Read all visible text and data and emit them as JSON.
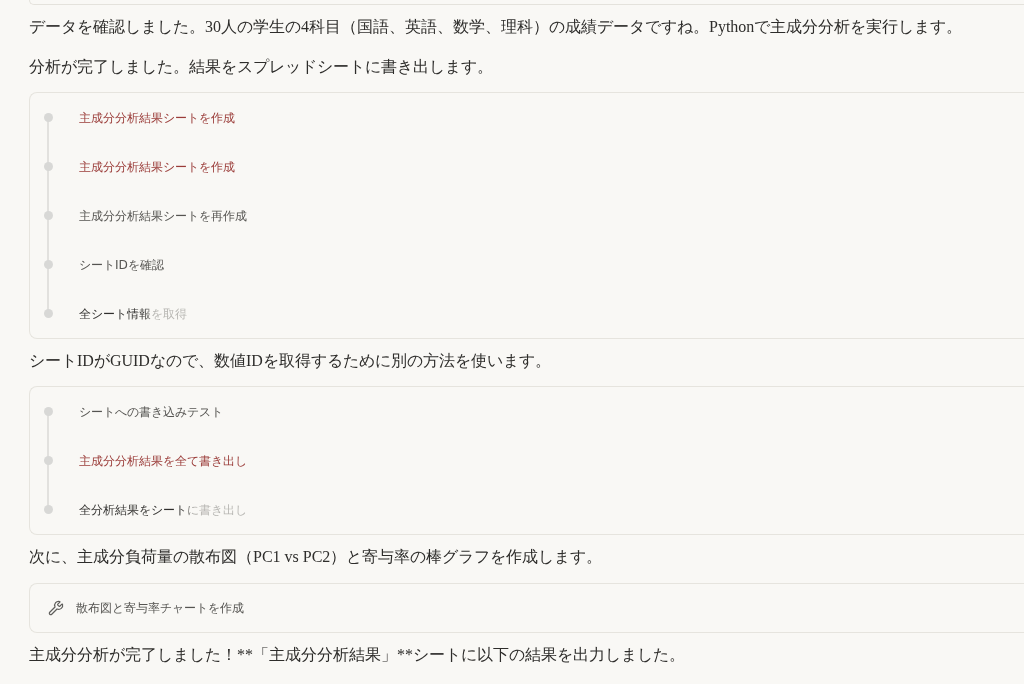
{
  "messages": [
    {
      "kind": "card_edge"
    },
    {
      "kind": "text",
      "text": "データを確認しました。30人の学生の4科目（国語、英語、数学、理科）の成績データですね。Pythonで主成分分析を実行します。"
    },
    {
      "kind": "text",
      "text": "分析が完了しました。結果をスプレッドシートに書き出します。"
    },
    {
      "kind": "steps",
      "steps": [
        {
          "label": "主成分分析結果シートを作成",
          "failed": true,
          "in_progress": false
        },
        {
          "label": "主成分分析結果シートを作成",
          "failed": true,
          "in_progress": false
        },
        {
          "label": "主成分分析結果シートを再作成",
          "failed": false,
          "in_progress": false
        },
        {
          "label": "シートIDを確認",
          "failed": false,
          "in_progress": false
        },
        {
          "label": "全シート情報を取得",
          "failed": false,
          "in_progress": true
        }
      ]
    },
    {
      "kind": "text",
      "text": "シートIDがGUIDなので、数値IDを取得するために別の方法を使います。"
    },
    {
      "kind": "steps",
      "steps": [
        {
          "label": "シートへの書き込みテスト",
          "failed": false,
          "in_progress": false
        },
        {
          "label": "主成分分析結果を全て書き出し",
          "failed": true,
          "in_progress": false
        },
        {
          "label": "全分析結果をシートに書き出し",
          "failed": false,
          "in_progress": true
        }
      ]
    },
    {
      "kind": "text",
      "text": "次に、主成分負荷量の散布図（PC1 vs PC2）と寄与率の棒グラフを作成します。"
    },
    {
      "kind": "tool",
      "label": "散布図と寄与率チャートを作成"
    },
    {
      "kind": "text",
      "text": "主成分分析が完了しました！**「主成分分析結果」**シートに以下の結果を出力しました。"
    }
  ]
}
